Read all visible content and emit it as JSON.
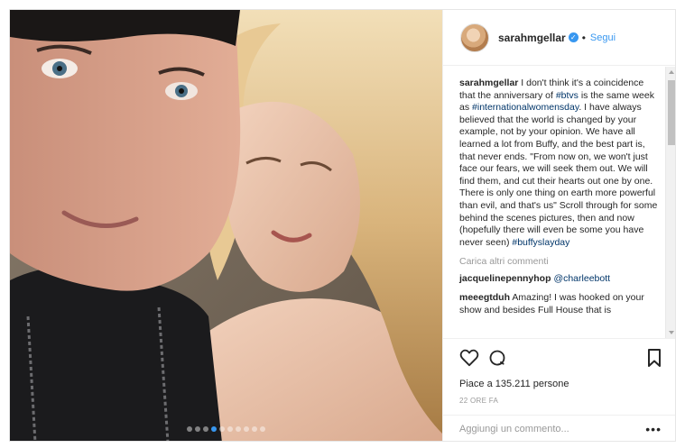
{
  "post": {
    "author": "sarahmgellar",
    "separator": "•",
    "follow_label": "Segui",
    "verified_icon": "verified-badge-icon",
    "carousel": {
      "count": 10,
      "active_index": 3
    }
  },
  "caption": {
    "author": "sarahmgellar",
    "p1": " I don't think it's a coincidence that the anniversary of ",
    "tag1": "#btvs",
    "p2": " is the same week as ",
    "tag2": "#internationalwomensday",
    "p3": ". I have always believed that the world is changed by your example, not by your opinion. We have all learned a lot from Buffy, and the best part is, that never ends. \"From now on, we won't just face our fears, we will seek them out. We will find them, and cut their hearts out one by one. There is only one thing on earth more powerful than evil, and that's us\" Scroll through for some behind the scenes pictures, then and now (hopefully there will even be some you have never seen) ",
    "tag3": "#buffyslayday"
  },
  "load_more": "Carica altri commenti",
  "comments": [
    {
      "user": "jacquelinepennyhop",
      "text": " ",
      "mention": "@charleebott"
    },
    {
      "user": "meeegtduh",
      "text": " Amazing! I was hooked on your show and besides Full House that is"
    }
  ],
  "actions": {
    "like_icon": "heart-icon",
    "comment_icon": "comment-bubble-icon",
    "save_icon": "bookmark-icon",
    "likes": "Piace a 135.211 persone",
    "time": "22 ORE FA"
  },
  "add_comment": {
    "placeholder": "Aggiungi un commento...",
    "more": "•••"
  }
}
